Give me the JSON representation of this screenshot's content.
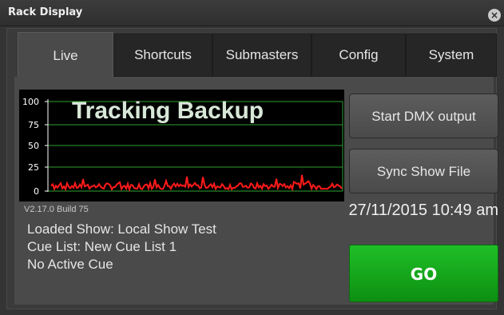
{
  "window": {
    "title": "Rack Display",
    "close_icon": "close-icon"
  },
  "tabs": [
    {
      "label": "Live",
      "active": true
    },
    {
      "label": "Shortcuts",
      "active": false
    },
    {
      "label": "Submasters",
      "active": false
    },
    {
      "label": "Config",
      "active": false
    },
    {
      "label": "System",
      "active": false
    }
  ],
  "graph": {
    "overlay_text": "Tracking Backup",
    "y_ticks": [
      "100",
      "75",
      "50",
      "25",
      "0"
    ],
    "line_color": "#ff1a1a",
    "grid_color": "#2fa12f"
  },
  "buttons": {
    "start_dmx": "Start DMX output",
    "sync_show": "Sync Show File",
    "go": "GO"
  },
  "status": {
    "version": "V2.17.0 Build 75",
    "datetime": "27/11/2015 10:49 am",
    "loaded_show": "Loaded Show: Local Show Test",
    "cue_list": "Cue List: New Cue List 1",
    "active_cue": "No Active Cue"
  },
  "colors": {
    "go_green": "#13a81a",
    "background": "#343434"
  }
}
